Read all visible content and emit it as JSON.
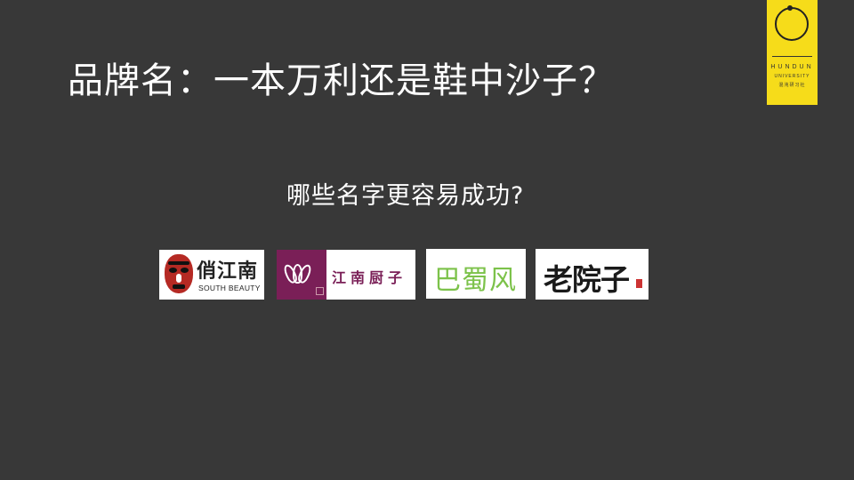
{
  "slide": {
    "title": "品牌名：一本万利还是鞋中沙子？",
    "question": "哪些名字更容易成功?"
  },
  "logo": {
    "line1": "HUNDUN",
    "line2": "UNIVERSITY",
    "line3": "混沌研习社",
    "color": "#f6dc1a"
  },
  "brands": [
    {
      "name": "俏江南",
      "sub": "SOUTH BEAUTY"
    },
    {
      "name": "江南厨子"
    },
    {
      "name": "巴蜀风"
    },
    {
      "name": "老院子"
    }
  ],
  "colors": {
    "background": "#383838",
    "text": "#ffffff",
    "jiangnan_chuzi": "#7a1f57",
    "bashufeng": "#7cc24a"
  }
}
